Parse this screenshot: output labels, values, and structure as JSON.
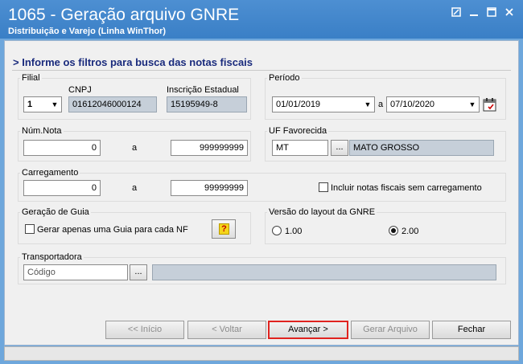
{
  "window": {
    "title": "1065 - Geração arquivo GNRE",
    "subtitle": "Distribuição e Varejo (Linha WinThor)",
    "controls": [
      "restore-icon",
      "minimize-icon",
      "maximize-icon",
      "close-icon"
    ]
  },
  "heading": "> Informe os filtros para busca das notas fiscais",
  "filial": {
    "group_label": "Filial",
    "value": "1",
    "cnpj_label": "CNPJ",
    "cnpj_value": "01612046000124",
    "ie_label": "Inscrição Estadual",
    "ie_value": "15195949-8"
  },
  "periodo": {
    "group_label": "Período",
    "start": "01/01/2019",
    "sep": "a",
    "end": "07/10/2020",
    "calendar_icon": "calendar-icon"
  },
  "num_nota": {
    "group_label": "Núm.Nota",
    "from": "0",
    "sep": "a",
    "to": "999999999"
  },
  "uf": {
    "group_label": "UF Favorecida",
    "code": "MT",
    "lookup_label": "...",
    "name": "MATO GROSSO"
  },
  "carregamento": {
    "group_label": "Carregamento",
    "from": "0",
    "sep": "a",
    "to": "99999999",
    "include_label": "Incluir notas fiscais sem carregamento",
    "include_checked": false
  },
  "guia": {
    "group_label": "Geração de Guia",
    "option_label": "Gerar apenas uma Guia para cada NF",
    "option_checked": false,
    "help_icon": "help-icon"
  },
  "layout": {
    "group_label": "Versão do layout da GNRE",
    "option_1": "1.00",
    "option_2": "2.00",
    "selected": "2.00"
  },
  "transportadora": {
    "group_label": "Transportadora",
    "placeholder": "Código",
    "lookup_label": "...",
    "name": ""
  },
  "buttons": {
    "inicio": "<< Início",
    "voltar": "< Voltar",
    "avancar": "Avançar >",
    "gerar": "Gerar Arquivo",
    "fechar": "Fechar"
  }
}
